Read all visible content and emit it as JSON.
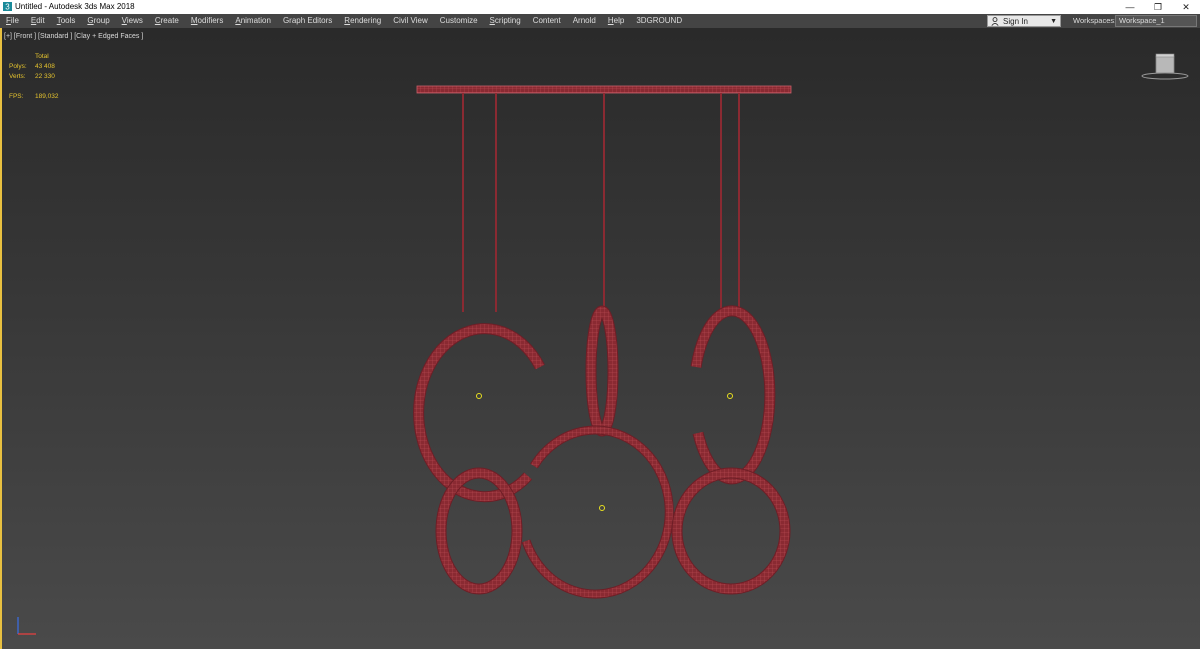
{
  "window": {
    "title": "Untitled - Autodesk 3ds Max 2018",
    "controls": {
      "minimize": "—",
      "restore": "❐",
      "close": "✕"
    }
  },
  "menu": {
    "items": [
      {
        "label": "File",
        "mnemonic": "F",
        "rest": "ile"
      },
      {
        "label": "Edit",
        "mnemonic": "E",
        "rest": "dit"
      },
      {
        "label": "Tools",
        "mnemonic": "T",
        "rest": "ools"
      },
      {
        "label": "Group",
        "mnemonic": "G",
        "rest": "roup"
      },
      {
        "label": "Views",
        "mnemonic": "V",
        "rest": "iews"
      },
      {
        "label": "Create",
        "mnemonic": "C",
        "rest": "reate"
      },
      {
        "label": "Modifiers",
        "mnemonic": "M",
        "rest": "odifiers"
      },
      {
        "label": "Animation",
        "mnemonic": "A",
        "rest": "nimation"
      },
      {
        "label": "Graph Editors",
        "mnemonic": "",
        "rest": "Graph Editors"
      },
      {
        "label": "Rendering",
        "mnemonic": "R",
        "rest": "endering"
      },
      {
        "label": "Civil View",
        "mnemonic": "",
        "rest": "Civil View"
      },
      {
        "label": "Customize",
        "mnemonic": "",
        "rest": "Customize"
      },
      {
        "label": "Scripting",
        "mnemonic": "S",
        "rest": "cripting"
      },
      {
        "label": "Content",
        "mnemonic": "",
        "rest": "Content"
      },
      {
        "label": "Arnold",
        "mnemonic": "",
        "rest": "Arnold"
      },
      {
        "label": "Help",
        "mnemonic": "H",
        "rest": "elp"
      },
      {
        "label": "3DGROUND",
        "mnemonic": "",
        "rest": "3DGROUND"
      }
    ],
    "sign_in": "Sign In",
    "workspaces_label": "Workspaces:",
    "workspace_value": "Workspace_1"
  },
  "viewport": {
    "label": "[+] [Front ] [Standard ] [Clay + Edged Faces ]",
    "stats": {
      "header": "Total",
      "polys_label": "Polys:",
      "polys_value": "43 408",
      "verts_label": "Verts:",
      "verts_value": "22 330",
      "fps_label": "FPS:",
      "fps_value": "189,032"
    },
    "colors": {
      "mesh_fill": "#8a2a32",
      "mesh_edge": "#c05058",
      "stats_text": "#e6c42e",
      "pivot": "#e8e020",
      "active_border": "#e8c040"
    }
  }
}
